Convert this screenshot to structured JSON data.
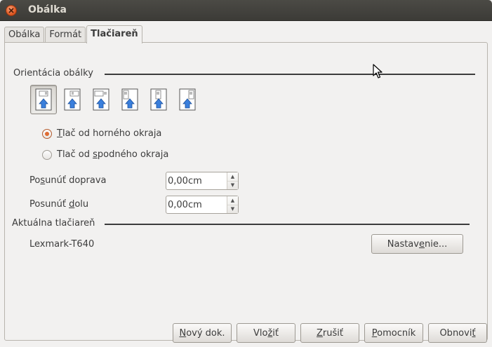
{
  "window": {
    "title": "Obálka"
  },
  "tabs": [
    {
      "label": "Obálka",
      "active": false
    },
    {
      "label": "Formát",
      "active": false
    },
    {
      "label": "Tlačiareň",
      "active": true
    }
  ],
  "orientation": {
    "section_label": "Orientácia obálky",
    "options_count": 6,
    "selected_index": 0,
    "icon_names": [
      "envelope-orient-1-icon",
      "envelope-orient-2-icon",
      "envelope-orient-3-icon",
      "envelope-orient-4-icon",
      "envelope-orient-5-icon",
      "envelope-orient-6-icon"
    ]
  },
  "feed": {
    "top": {
      "pre": "",
      "key": "T",
      "post": "lač od horného okraja",
      "checked": true
    },
    "bottom": {
      "pre": "Tlač od ",
      "key": "s",
      "post": "podného okraja",
      "checked": false
    }
  },
  "shift_right": {
    "pre": "Po",
    "key": "s",
    "post": "unúť doprava",
    "value": "0,00cm"
  },
  "shift_down": {
    "pre": "Posunúť ",
    "key": "d",
    "post": "olu",
    "value": "0,00cm"
  },
  "printer": {
    "section_label": "Aktuálna tlačiareň",
    "name": "Lexmark-T640",
    "setup": {
      "pre": "Nastav",
      "key": "e",
      "post": "nie..."
    }
  },
  "buttons": {
    "new_doc": {
      "pre": "",
      "key": "N",
      "post": "ový dok."
    },
    "insert": {
      "pre": "Vlo",
      "key": "ž",
      "post": "iť"
    },
    "cancel": {
      "pre": "",
      "key": "Z",
      "post": "rušiť"
    },
    "help": {
      "pre": "",
      "key": "P",
      "post": "omocník"
    },
    "reset": {
      "pre": "Obnovi",
      "key": "ť",
      "post": ""
    }
  },
  "colors": {
    "accent": "#df6c33",
    "titlebar": "#3c3b37",
    "arrow": "#2f6fd0"
  }
}
